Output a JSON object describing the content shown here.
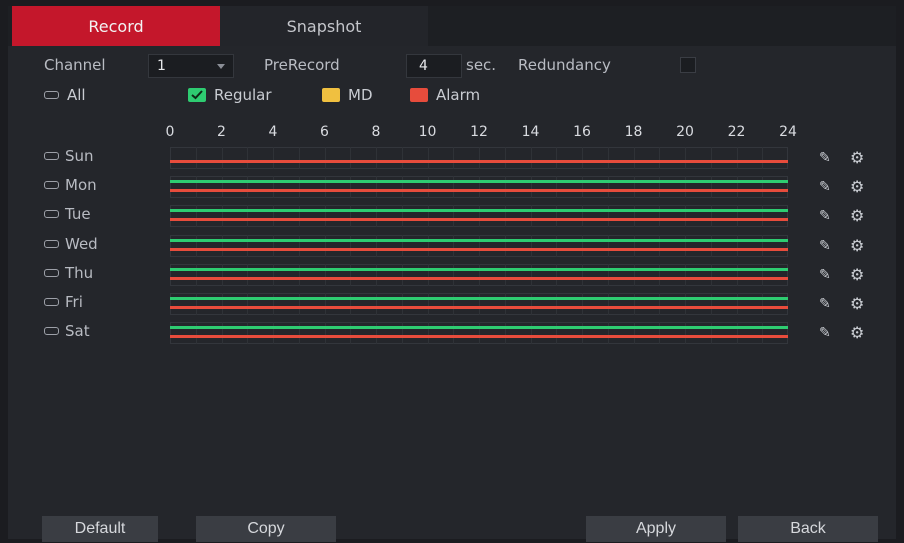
{
  "tabs": [
    {
      "label": "Record",
      "active": true
    },
    {
      "label": "Snapshot",
      "active": false
    }
  ],
  "settings": {
    "channel_label": "Channel",
    "channel_value": "1",
    "prerecord_label": "PreRecord",
    "prerecord_value": "4",
    "sec_label": "sec.",
    "redundancy_label": "Redundancy",
    "redundancy_checked": false
  },
  "legend": {
    "all_label": "All",
    "items": [
      {
        "label": "Regular",
        "color": "#2ecc71"
      },
      {
        "label": "MD",
        "color": "#f0c040"
      },
      {
        "label": "Alarm",
        "color": "#e74c3c"
      }
    ]
  },
  "hours": [
    "0",
    "2",
    "4",
    "6",
    "8",
    "10",
    "12",
    "14",
    "16",
    "18",
    "20",
    "22",
    "24"
  ],
  "days": [
    {
      "label": "Sun",
      "regular": false,
      "alarm": true
    },
    {
      "label": "Mon",
      "regular": true,
      "alarm": true
    },
    {
      "label": "Tue",
      "regular": true,
      "alarm": true
    },
    {
      "label": "Wed",
      "regular": true,
      "alarm": true
    },
    {
      "label": "Thu",
      "regular": true,
      "alarm": true
    },
    {
      "label": "Fri",
      "regular": true,
      "alarm": true
    },
    {
      "label": "Sat",
      "regular": true,
      "alarm": true
    }
  ],
  "icons": {
    "edit": "pencil-icon",
    "settings": "gear-icon"
  },
  "buttons": {
    "default": "Default",
    "copy": "Copy",
    "apply": "Apply",
    "back": "Back"
  }
}
